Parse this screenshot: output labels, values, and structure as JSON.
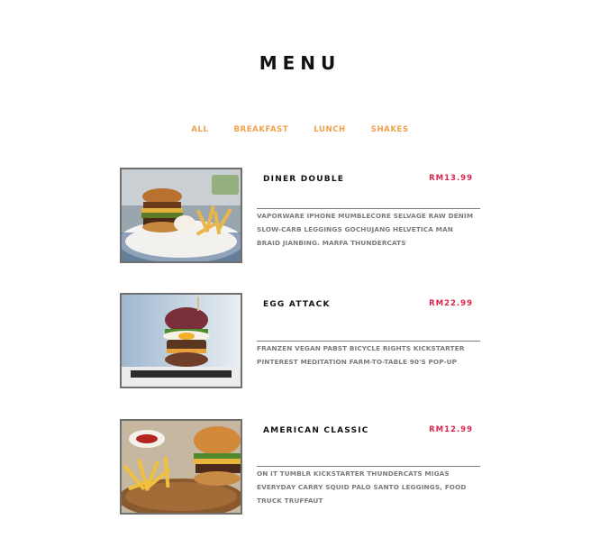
{
  "page": {
    "title": "MENU"
  },
  "tabs": [
    {
      "label": "ALL"
    },
    {
      "label": "BREAKFAST"
    },
    {
      "label": "LUNCH"
    },
    {
      "label": "SHAKES"
    }
  ],
  "items": [
    {
      "name": "DINER DOUBLE",
      "price": "RM13.99",
      "description": "VAPORWARE IPHONE MUMBLECORE SELVAGE RAW DENIM SLOW-CARB LEGGINGS GOCHUJANG HELVETICA MAN BRAID JIANBING. MARFA THUNDERCATS",
      "image_icon": "burger-fries-photo"
    },
    {
      "name": "EGG ATTACK",
      "price": "RM22.99",
      "description": "FRANZEN VEGAN PABST BICYCLE RIGHTS KICKSTARTER PINTEREST MEDITATION FARM-TO-TABLE 90'S POP-UP",
      "image_icon": "egg-burger-photo"
    },
    {
      "name": "AMERICAN CLASSIC",
      "price": "RM12.99",
      "description": "ON IT TUMBLR KICKSTARTER THUNDERCATS MIGAS EVERYDAY CARRY SQUID PALO SANTO LEGGINGS, FOOD TRUCK TRUFFAUT",
      "image_icon": "classic-burger-photo"
    }
  ],
  "colors": {
    "tab_accent": "#f0a04b",
    "price": "#d7264e",
    "heading": "#111111",
    "description": "#7b7b7b"
  }
}
